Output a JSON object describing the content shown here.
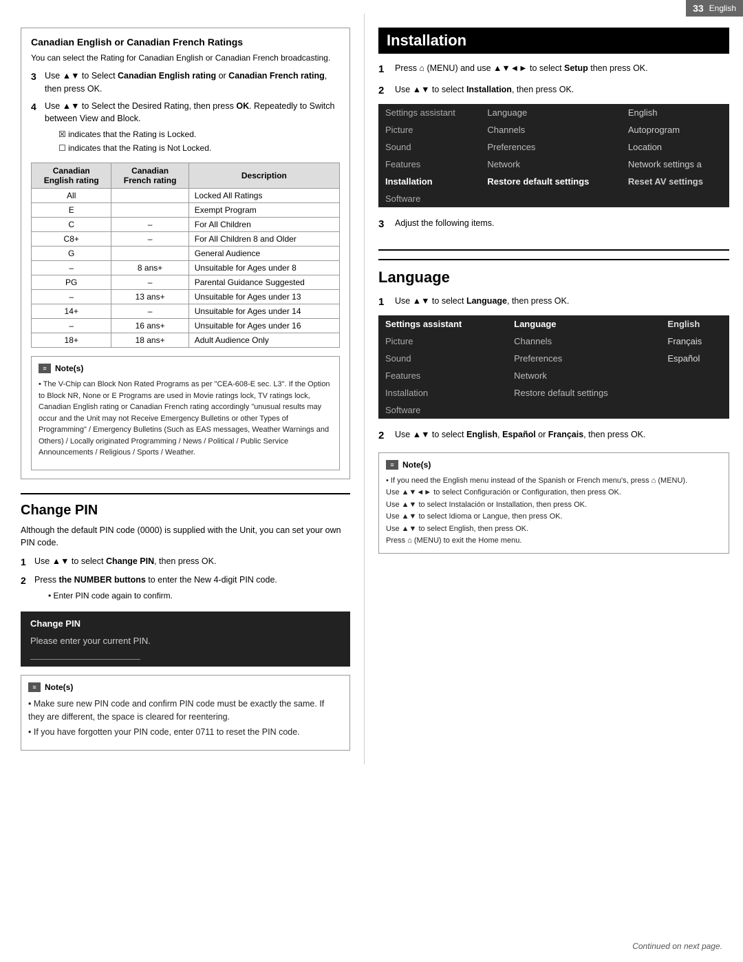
{
  "topbar": {
    "page_number": "33",
    "language": "English"
  },
  "left": {
    "canadian_section": {
      "title": "Canadian English or Canadian French Ratings",
      "desc": "You can select the Rating for Canadian English or Canadian French broadcasting.",
      "step3": {
        "num": "3",
        "text": "Use ▲▼ to Select Canadian English rating or Canadian French rating, then press OK."
      },
      "step4": {
        "num": "4",
        "text": "Use ▲▼ to Select the Desired Rating, then press OK. Repeatedly to Switch between View and Block.",
        "bullet1": "☒ indicates that the Rating is Locked.",
        "bullet2": "☐ indicates that the Rating is Not Locked."
      },
      "table": {
        "headers": [
          "Canadian\nEnglish rating",
          "Canadian\nFrench rating",
          "Description"
        ],
        "rows": [
          {
            "col1": "All",
            "col2": "",
            "desc": "Locked All Ratings"
          },
          {
            "col1": "E",
            "col2": "",
            "desc": "Exempt Program"
          },
          {
            "col1": "C",
            "col2": "–",
            "desc": "For All Children"
          },
          {
            "col1": "C8+",
            "col2": "–",
            "desc": "For All Children 8 and Older"
          },
          {
            "col1": "G",
            "col2": "",
            "desc": "General Audience"
          },
          {
            "col1": "–",
            "col2": "8 ans+",
            "desc": "Unsuitable for Ages under 8"
          },
          {
            "col1": "PG",
            "col2": "–",
            "desc": "Parental Guidance Suggested"
          },
          {
            "col1": "–",
            "col2": "13 ans+",
            "desc": "Unsuitable for Ages under 13"
          },
          {
            "col1": "14+",
            "col2": "–",
            "desc": "Unsuitable for Ages under 14"
          },
          {
            "col1": "–",
            "col2": "16 ans+",
            "desc": "Unsuitable for Ages under 16"
          },
          {
            "col1": "18+",
            "col2": "18 ans+",
            "desc": "Adult Audience Only"
          }
        ]
      },
      "notes_title": "Note(s)",
      "notes_text": "• The V-Chip can Block Non Rated Programs as per \"CEA-608-E sec. L3\". If the Option to Block NR, None or E Programs are used in Movie ratings lock, TV ratings lock, Canadian English rating or Canadian French rating accordingly \"unusual results may occur and the Unit may not Receive Emergency Bulletins or other Types of Programming\" / Emergency Bulletins (Such as EAS messages, Weather Warnings and Others) / Locally originated Programming / News / Political / Public Service Announcements / Religious / Sports / Weather."
    },
    "pin_section": {
      "title": "Change PIN",
      "desc": "Although the default PIN code (0000) is supplied with the Unit, you can set your own PIN code.",
      "step1_num": "1",
      "step1_text": "Use ▲▼ to select Change PIN, then press OK.",
      "step2_num": "2",
      "step2_text": "Press the NUMBER buttons to enter the New 4-digit PIN code.",
      "step2_bullet": "• Enter PIN code again to confirm.",
      "pin_dialog": {
        "title": "Change PIN",
        "text": "Please enter your current PIN."
      },
      "notes_title": "Note(s)",
      "notes_line1": "• Make sure new PIN code and confirm PIN code must be exactly the same. If they are different, the space is cleared for reentering.",
      "notes_line2": "• If you have forgotten your PIN code, enter 0711 to reset the PIN code."
    }
  },
  "right": {
    "installation": {
      "title": "Installation",
      "step1_num": "1",
      "step1_text": "Press",
      "step1_icon": "⌂",
      "step1_rest": "(MENU) and use ▲▼◄► to select Setup then press OK.",
      "step2_num": "2",
      "step2_text": "Use ▲▼ to select Installation, then press OK.",
      "menu1": {
        "rows": [
          {
            "col1": "Settings assistant",
            "col2": "Language",
            "col3": "English"
          },
          {
            "col1": "Picture",
            "col2": "Channels",
            "col3": "Autoprogram"
          },
          {
            "col1": "Sound",
            "col2": "Preferences",
            "col3": "Location"
          },
          {
            "col1": "Features",
            "col2": "Network",
            "col3": "Network settings a"
          },
          {
            "col1": "Installation",
            "col2": "Restore default settings",
            "col3": "Reset AV settings"
          },
          {
            "col1": "Software",
            "col2": "",
            "col3": ""
          }
        ],
        "active_row": 4
      },
      "step3_num": "3",
      "step3_text": "Adjust the following items."
    },
    "language": {
      "title": "Language",
      "step1_num": "1",
      "step1_text": "Use ▲▼ to select Language, then press OK.",
      "menu2": {
        "rows": [
          {
            "col1": "Settings assistant",
            "col2": "Language",
            "col3": "English"
          },
          {
            "col1": "Picture",
            "col2": "Channels",
            "col3": "Français"
          },
          {
            "col1": "Sound",
            "col2": "Preferences",
            "col3": "Español"
          },
          {
            "col1": "Features",
            "col2": "Network",
            "col3": ""
          },
          {
            "col1": "Installation",
            "col2": "Restore default settings",
            "col3": ""
          },
          {
            "col1": "Software",
            "col2": "",
            "col3": ""
          }
        ],
        "active_row": 0
      },
      "step2_num": "2",
      "step2_text": "Use ▲▼ to select English, Español or Français, then press OK.",
      "notes_title": "Note(s)",
      "notes_lines": [
        "• If you need the English menu instead of the Spanish or French menu's, press ⌂ (MENU).",
        "  Use ▲▼◄► to select Configuración or Configuration, then press OK.",
        "  Use ▲▼ to select Instalación or Installation, then press OK.",
        "  Use ▲▼ to select Idioma or Langue, then press OK.",
        "  Use ▲▼ to select English, then press OK.",
        "  Press ⌂ (MENU) to exit the Home menu."
      ]
    }
  },
  "footer": {
    "text": "Continued on next page."
  }
}
